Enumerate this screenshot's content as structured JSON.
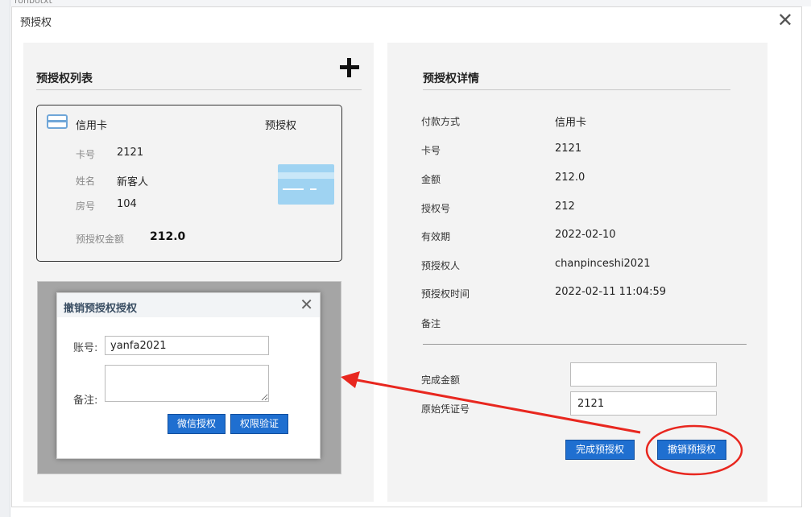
{
  "background": {
    "top_text": "ronbotxt"
  },
  "dialog": {
    "title": "预授权",
    "close_glyph": "✕"
  },
  "left_panel": {
    "title": "预授权列表",
    "add_icon": "plus-icon",
    "card": {
      "payment_type": "信用卡",
      "kind": "预授权",
      "rows": [
        {
          "label": "卡号",
          "value": "2121"
        },
        {
          "label": "姓名",
          "value": "新客人"
        },
        {
          "label": "房号",
          "value": "104"
        }
      ],
      "amount_label": "预授权金额",
      "amount_value": "212.0"
    }
  },
  "popup": {
    "title": "撤销预授权授权",
    "close_glyph": "✕",
    "account_label": "账号:",
    "account_value": "yanfa2021",
    "remark_label": "备注:",
    "remark_value": "",
    "buttons": {
      "wechat": "微信授权",
      "verify": "权限验证"
    }
  },
  "right_panel": {
    "title": "预授权详情",
    "rows": [
      {
        "label": "付款方式",
        "value": "信用卡"
      },
      {
        "label": "卡号",
        "value": "2121"
      },
      {
        "label": "金额",
        "value": "212.0"
      },
      {
        "label": "授权号",
        "value": "212"
      },
      {
        "label": "有效期",
        "value": "2022-02-10"
      },
      {
        "label": "预授权人",
        "value": "chanpinceshi2021"
      },
      {
        "label": "预授权时间",
        "value": "2022-02-11 11:04:59"
      },
      {
        "label": "备注",
        "value": ""
      }
    ],
    "complete_amount_label": "完成金额",
    "complete_amount_value": "",
    "voucher_label": "原始凭证号",
    "voucher_value": "2121",
    "buttons": {
      "complete": "完成预授权",
      "cancel": "撤销预授权"
    }
  },
  "colors": {
    "accent_blue": "#1f6fd0",
    "annotation_red": "#e8271f",
    "card_blue": "#9fd3f2"
  }
}
